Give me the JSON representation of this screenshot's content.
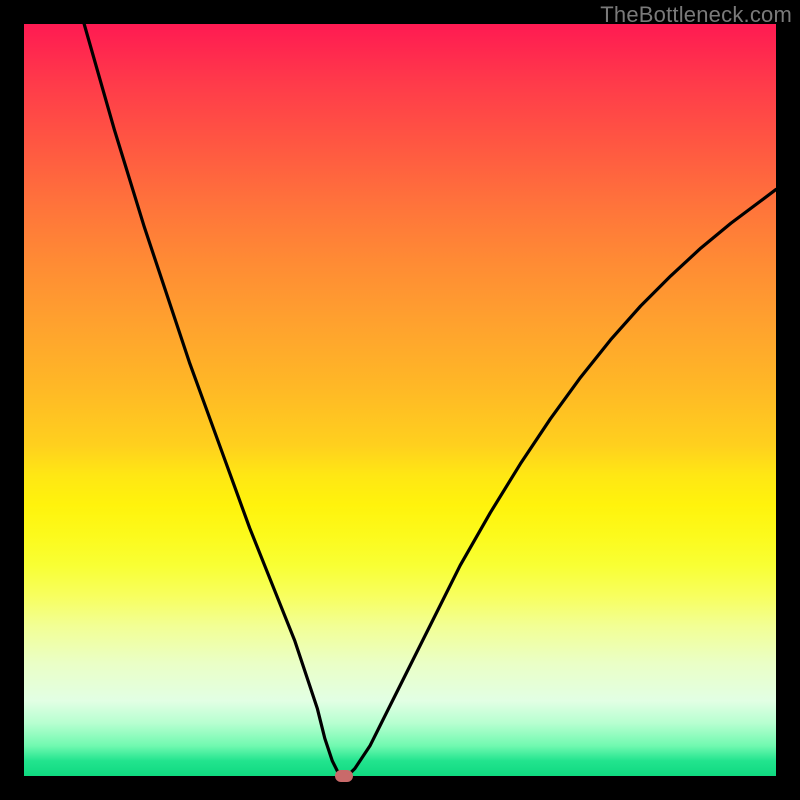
{
  "watermark": "TheBottleneck.com",
  "chart_data": {
    "type": "line",
    "title": "",
    "xlabel": "",
    "ylabel": "",
    "xlim": [
      0,
      100
    ],
    "ylim": [
      0,
      100
    ],
    "grid": false,
    "legend": false,
    "series": [
      {
        "name": "bottleneck-curve",
        "x": [
          8,
          10,
          12,
          14,
          16,
          18,
          20,
          22,
          24,
          26,
          28,
          30,
          32,
          34,
          36,
          38,
          39,
          40,
          41,
          42,
          43,
          44,
          46,
          48,
          50,
          54,
          58,
          62,
          66,
          70,
          74,
          78,
          82,
          86,
          90,
          94,
          98,
          100
        ],
        "y": [
          100,
          93,
          86,
          79.5,
          73,
          67,
          61,
          55,
          49.5,
          44,
          38.5,
          33,
          28,
          23,
          18,
          12,
          9,
          5,
          2,
          0,
          0,
          1,
          4,
          8,
          12,
          20,
          28,
          35,
          41.5,
          47.5,
          53,
          58,
          62.5,
          66.5,
          70.2,
          73.5,
          76.5,
          78
        ]
      }
    ],
    "marker": {
      "x": 42.5,
      "y": 0
    },
    "background_gradient": {
      "top": "#ff1a52",
      "mid": "#fff30c",
      "bottom": "#0fd980"
    },
    "curve_color": "#000000",
    "marker_color": "#c96a6a"
  }
}
